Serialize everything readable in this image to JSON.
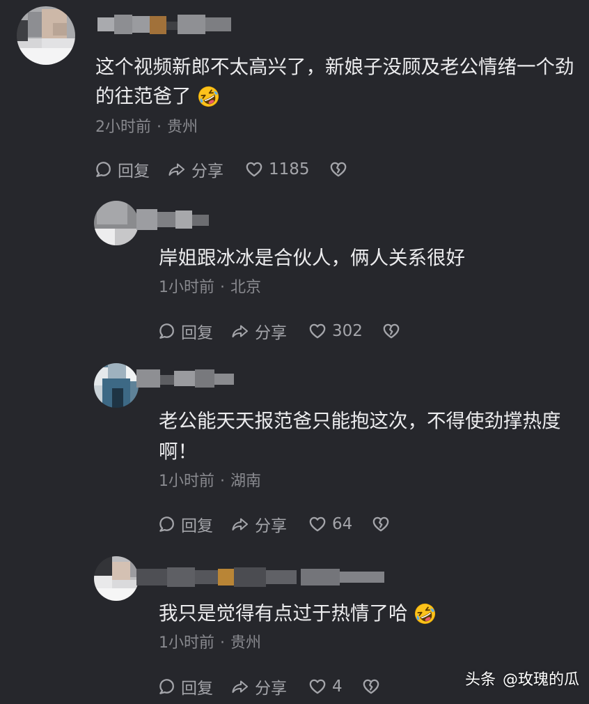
{
  "theme": {
    "background": "#26272c",
    "text_primary": "#ececee",
    "text_secondary": "#898a8f",
    "action_color": "#a4a5aa",
    "watermark_color": "#ffffff"
  },
  "icons": {
    "reply": "comment-bubble-icon",
    "share": "share-arrow-icon",
    "like": "heart-icon",
    "dislike": "broken-heart-icon",
    "emoji": "rolling-on-floor-laughing-icon"
  },
  "meta_separator": "·",
  "comments": [
    {
      "text_lines": [
        "这个视频新郎不太高兴了，新娘子没顾及老公情绪一个劲",
        "的往范爸了"
      ],
      "trailing_emoji": "rolling-on-floor-laughing-icon",
      "time": "2小时前",
      "location": "贵州",
      "reply_label": "回复",
      "share_label": "分享",
      "likes": "1185"
    },
    {
      "text_lines": [
        "岸姐跟冰冰是合伙人，俩人关系很好"
      ],
      "time": "1小时前",
      "location": "北京",
      "reply_label": "回复",
      "share_label": "分享",
      "likes": "302"
    },
    {
      "text_lines": [
        "老公能天天报范爸只能抱这次，不得使劲撑热度",
        "啊！"
      ],
      "time": "1小时前",
      "location": "湖南",
      "reply_label": "回复",
      "share_label": "分享",
      "likes": "64"
    },
    {
      "text_lines": [
        "我只是觉得有点过于热情了哈"
      ],
      "trailing_emoji": "rolling-on-floor-laughing-icon",
      "time": "1小时前",
      "location": "贵州",
      "reply_label": "回复",
      "share_label": "分享",
      "likes": "4"
    }
  ],
  "watermark": {
    "platform": "头条",
    "account": "@玫瑰的瓜"
  }
}
